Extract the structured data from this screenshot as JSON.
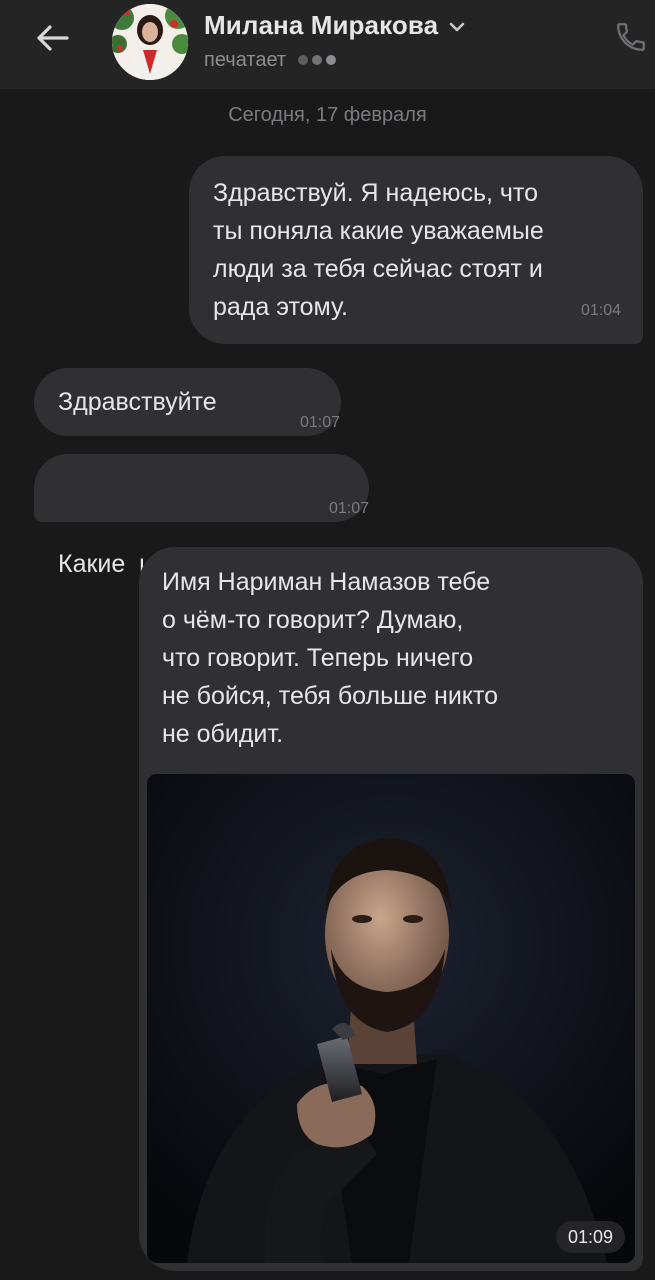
{
  "header": {
    "contact_name": "Милана Миракова",
    "status": "печатает",
    "icons": {
      "back": "arrow-left-icon",
      "dropdown": "chevron-down-icon",
      "call": "phone-icon",
      "typing": "typing-dots-icon"
    }
  },
  "date_divider": "Сегодня, 17 февраля",
  "messages": [
    {
      "direction": "outgoing",
      "lines": [
        "Здравствуй. Я надеюсь, что",
        "ты поняла какие уважаемые",
        "люди за тебя сейчас стоят и",
        "рада этому."
      ],
      "time": "01:04"
    },
    {
      "direction": "incoming",
      "lines": [
        "Здравствуйте"
      ],
      "time": "01:07"
    },
    {
      "direction": "incoming",
      "lines": [
        "Какие  именно?"
      ],
      "time": "01:07"
    },
    {
      "direction": "outgoing",
      "lines": [
        "Имя Нариман Намазов тебе",
        "о чём-то говорит? Думаю,",
        "что говорит. Теперь ничего",
        "не бойся, тебя больше никто",
        "не обидит."
      ],
      "attachment": {
        "type": "photo",
        "time": "01:09"
      }
    }
  ],
  "colors": {
    "background": "#19191a",
    "header": "#242425",
    "bubble": "#303032",
    "text": "#e6e6e7",
    "secondary_text": "#8c8d90"
  }
}
